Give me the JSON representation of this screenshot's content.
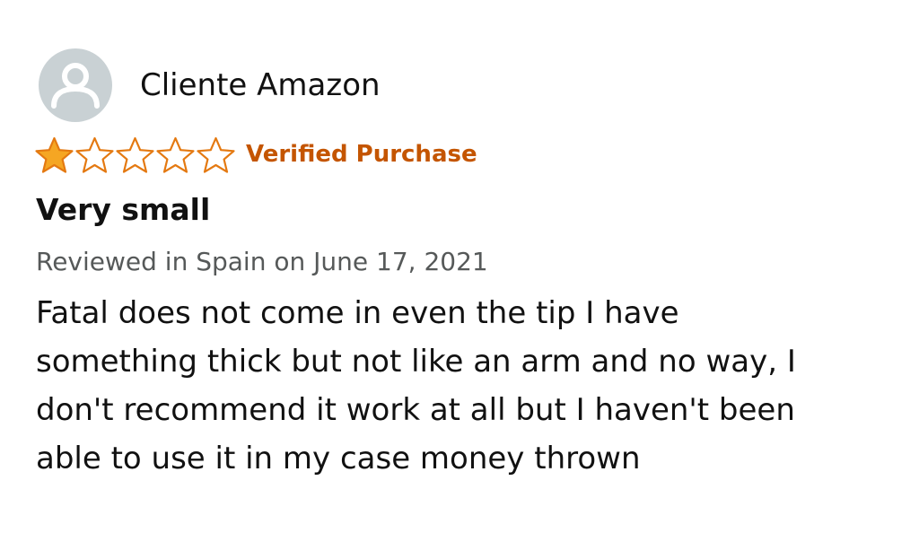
{
  "profile": {
    "name": "Cliente Amazon",
    "avatar_icon": "user-silhouette-icon"
  },
  "rating": {
    "value": 1,
    "max": 5,
    "star_color": "#f5a623",
    "star_outline_color": "#e47911"
  },
  "badge": {
    "label": "Verified Purchase",
    "color": "#c45500"
  },
  "review": {
    "title": "Very small",
    "date": "Reviewed in Spain on June 17, 2021",
    "body_lines": [
      "Fatal does not come in even the tip I have",
      "something thick but not like an arm and no way, I",
      "don't recommend it work at all but I haven't been",
      "able to use it in my case money thrown"
    ]
  }
}
